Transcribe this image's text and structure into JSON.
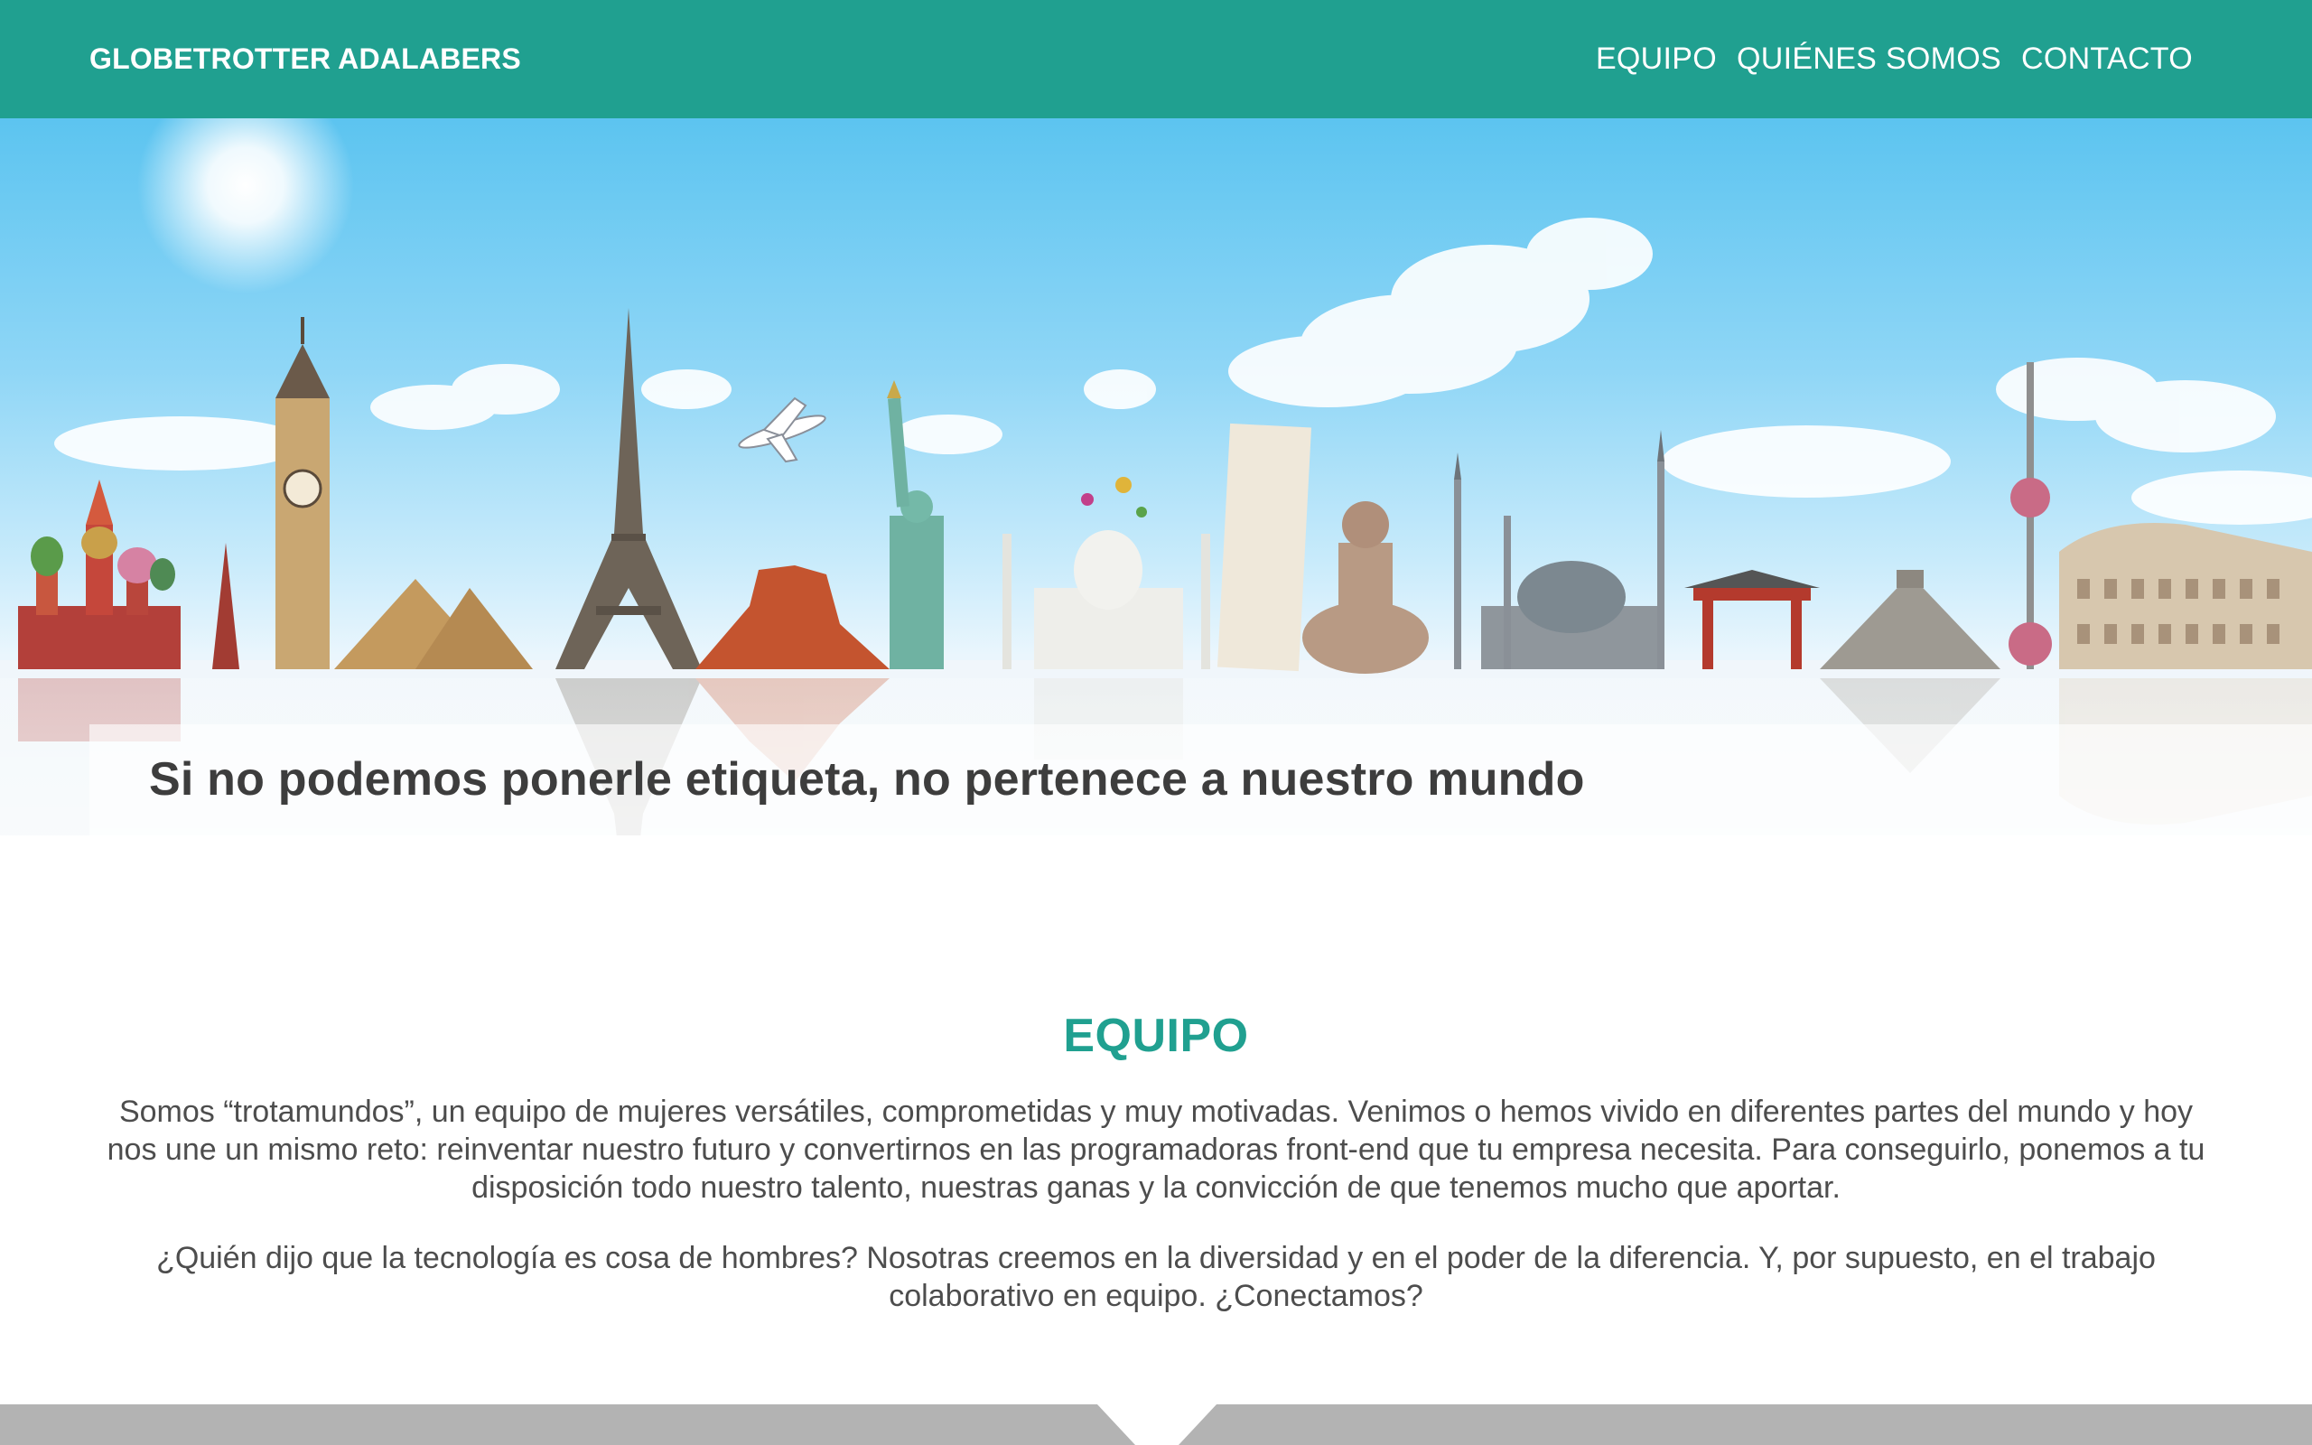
{
  "header": {
    "brand": "GLOBETROTTER ADALABERS",
    "nav": [
      {
        "label": "EQUIPO"
      },
      {
        "label": "QUIÉNES SOMOS"
      },
      {
        "label": "CONTACTO"
      }
    ]
  },
  "hero": {
    "tagline": "Si no podemos ponerle etiqueta, no pertenece a nuestro mundo"
  },
  "team": {
    "title": "EQUIPO",
    "paragraph_1": "Somos “trotamundos”, un equipo de mujeres versátiles, comprometidas y muy motivadas. Venimos o hemos vivido en diferentes partes del mundo y hoy nos une un mismo reto: reinventar nuestro futuro y convertirnos en las programadoras front-end que tu empresa necesita. Para conseguirlo, ponemos a tu disposición todo nuestro talento, nuestras ganas y la convicción de que tenemos mucho que aportar.",
    "paragraph_2": "¿Quién dijo que la tecnología es cosa de hombres? Nosotras creemos en la diversidad y en el poder de la diferencia. Y, por supuesto, en el trabajo colaborativo en equipo. ¿Conectamos?"
  },
  "colors": {
    "accent": "#20a090",
    "text": "#4d4d4d",
    "footer": "#b3b3b3"
  }
}
